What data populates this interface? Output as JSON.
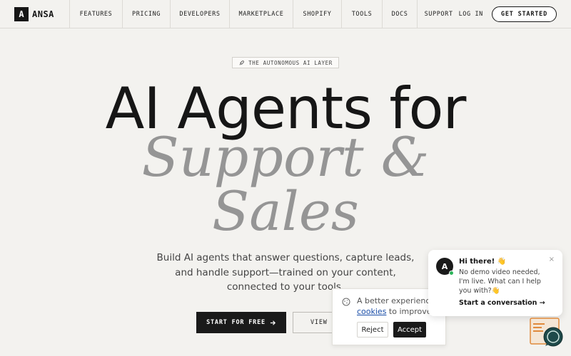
{
  "brand": {
    "logo_letter": "A",
    "name": "ANSA"
  },
  "nav": {
    "links": [
      "FEATURES",
      "PRICING",
      "DEVELOPERS",
      "MARKETPLACE",
      "SHOPIFY",
      "TOOLS",
      "DOCS"
    ],
    "support": "SUPPORT",
    "login": "LOG IN",
    "cta": "GET STARTED"
  },
  "hero": {
    "pill": "THE AUTONOMOUS AI LAYER",
    "headline": "AI Agents for",
    "headline_italic_1": "Support &",
    "headline_italic_2": "Sales",
    "subtitle": "Build AI agents that answer questions, capture leads, and handle support—trained on your content, connected to your tools.",
    "start_button": "START FOR FREE",
    "view_button": "VIEW F"
  },
  "cookie": {
    "text_line1": "A better experience",
    "link": "cookies",
    "text_line2": " to improve u",
    "reject": "Reject",
    "accept": "Accept"
  },
  "chat": {
    "avatar_letter": "A",
    "title": "Hi there! 👋",
    "message": "No demo video needed, I'm live. What can I help you with?👋",
    "cta": "Start a conversation →",
    "close": "×"
  },
  "colors": {
    "accent": "#161616",
    "muted_heading": "#959595",
    "online": "#2cb45a",
    "background": "#f3f2ef"
  }
}
